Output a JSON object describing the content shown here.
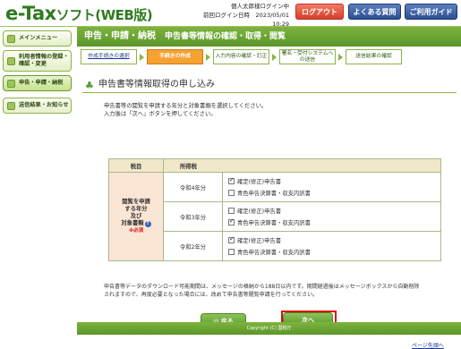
{
  "header": {
    "logo_main": "e-Tax",
    "logo_sub": "ソフト(WEB版)",
    "user_line1": "個人太郎様ログイン中",
    "user_line2": "前回ログイン日時　2023/05/01　10:29",
    "logout": "ログアウト",
    "faq": "よくある質問",
    "guide": "ご利用ガイド"
  },
  "sidebar": {
    "items": [
      {
        "label": "メインメニュー"
      },
      {
        "label": "利用者情報の登録・確認・変更"
      },
      {
        "label": "申告・申請・納税"
      },
      {
        "label": "送信結果・お知らせ"
      }
    ]
  },
  "title": {
    "main": "申告・申請・納税",
    "sub": "申告書等情報の確認・取得・閲覧"
  },
  "steps": [
    {
      "label": "作成手続きの選択"
    },
    {
      "label": "手続きの作成"
    },
    {
      "label": "入力内容の確認・訂正"
    },
    {
      "label": "署名・受付システムへの送信"
    },
    {
      "label": "送信結果の確認"
    }
  ],
  "page_title": "申告書等情報取得の申し込み",
  "description": {
    "line1": "申告書等の閲覧を申請する年分と対象書類を選択してください。",
    "line2": "入力後は「次へ」ボタンを押してください。"
  },
  "table": {
    "col1": "税目",
    "col2": "所得税",
    "label_line1": "閲覧を申請",
    "label_line2": "する年分",
    "label_line3": "及び",
    "label_line4": "対象書類",
    "required": "※必須",
    "rows": [
      {
        "year": "令和4年分",
        "opt1": "確定(修正)申告書",
        "opt2": "青色申告決算書・収支内訳書",
        "opt1_checked": true,
        "opt2_checked": false
      },
      {
        "year": "令和3年分",
        "opt1": "確定(修正)申告書",
        "opt2": "青色申告決算書・収支内訳書",
        "opt1_checked": false,
        "opt2_checked": true
      },
      {
        "year": "令和2年分",
        "opt1": "確定(修正)申告書",
        "opt2": "青色申告決算書・収支内訳書",
        "opt1_checked": true,
        "opt2_checked": false
      }
    ]
  },
  "note": {
    "line1": "申告書等データのダウンロード可能期間は、メッセージの格納から188日以内です。期間経過後はメッセージボックスから自動削除",
    "line2": "されますので、再度必要となった場合には、改めて申告書等閲覧申請を行ってください。"
  },
  "buttons": {
    "back": "◎ 戻る",
    "next": "次へ"
  },
  "page_top": "ページ先頭へ",
  "footer": "Copyright (C) 国税庁"
}
